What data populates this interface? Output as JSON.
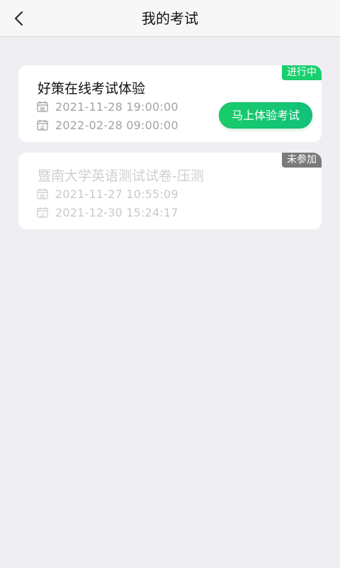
{
  "header": {
    "title": "我的考试",
    "back_icon": "chevron-left-icon"
  },
  "exams": [
    {
      "title": "好策在线考试体验",
      "status": "进行中",
      "status_color": "#19CF6E",
      "start_time": "2021-11-28 19:00:00",
      "end_time": "2022-02-28 09:00:00",
      "start_icon_char": "始",
      "end_icon_char": "止",
      "action_label": "马上体验考试",
      "action_color": "#19CC69"
    },
    {
      "title": "暨南大学英语测试试卷-压测",
      "status": "未参加",
      "status_color": "#7A7A7A",
      "start_time": "2021-11-27 10:55:09",
      "end_time": "2021-12-30 15:24:17",
      "start_icon_char": "始",
      "end_icon_char": "止"
    }
  ]
}
